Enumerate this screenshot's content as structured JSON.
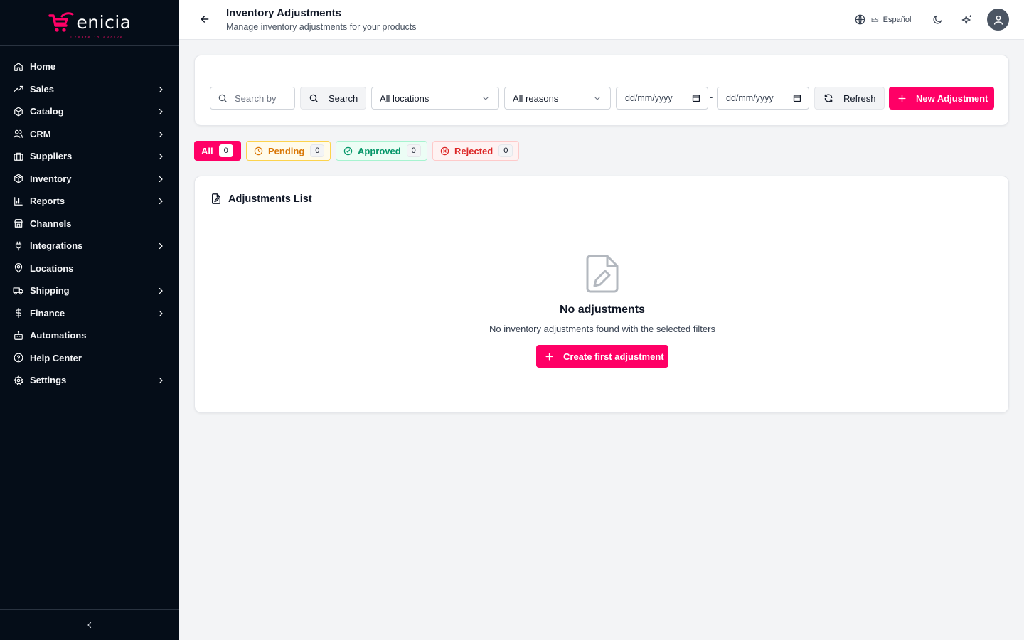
{
  "brand": {
    "name": "enicia",
    "tagline": "Create to evolve",
    "accent": "#ff0066"
  },
  "sidebar": {
    "items": [
      {
        "label": "Home",
        "icon": "home-icon",
        "has_submenu": false
      },
      {
        "label": "Sales",
        "icon": "trending-up-icon",
        "has_submenu": true
      },
      {
        "label": "Catalog",
        "icon": "package-icon",
        "has_submenu": true
      },
      {
        "label": "CRM",
        "icon": "users-icon",
        "has_submenu": true
      },
      {
        "label": "Suppliers",
        "icon": "briefcase-icon",
        "has_submenu": true
      },
      {
        "label": "Inventory",
        "icon": "box-icon",
        "has_submenu": true
      },
      {
        "label": "Reports",
        "icon": "bar-chart-icon",
        "has_submenu": true
      },
      {
        "label": "Channels",
        "icon": "store-icon",
        "has_submenu": false
      },
      {
        "label": "Integrations",
        "icon": "plug-icon",
        "has_submenu": true
      },
      {
        "label": "Locations",
        "icon": "map-pin-icon",
        "has_submenu": false
      },
      {
        "label": "Shipping",
        "icon": "truck-icon",
        "has_submenu": true
      },
      {
        "label": "Finance",
        "icon": "dollar-icon",
        "has_submenu": true
      },
      {
        "label": "Automations",
        "icon": "bot-icon",
        "has_submenu": false
      },
      {
        "label": "Help Center",
        "icon": "help-circle-icon",
        "has_submenu": false
      },
      {
        "label": "Settings",
        "icon": "gear-icon",
        "has_submenu": true
      }
    ]
  },
  "header": {
    "title": "Inventory Adjustments",
    "subtitle": "Manage inventory adjustments for your products",
    "language_code": "ES",
    "language_name": "Español"
  },
  "filters": {
    "search_placeholder": "Search by",
    "search_button": "Search",
    "location_select": "All locations",
    "reason_select": "All reasons",
    "date_from": "dd/mm/yyyy",
    "date_separator": "-",
    "date_to": "dd/mm/yyyy",
    "refresh_button": "Refresh",
    "new_button": "New Adjustment"
  },
  "tabs": [
    {
      "label": "All",
      "count": "0",
      "color": "#ff0066"
    },
    {
      "label": "Pending",
      "count": "0",
      "color": "#d97706"
    },
    {
      "label": "Approved",
      "count": "0",
      "color": "#059669"
    },
    {
      "label": "Rejected",
      "count": "0",
      "color": "#dc2626"
    }
  ],
  "list": {
    "title": "Adjustments List",
    "empty_title": "No adjustments",
    "empty_desc": "No inventory adjustments found with the selected filters",
    "create_button": "Create first adjustment"
  }
}
